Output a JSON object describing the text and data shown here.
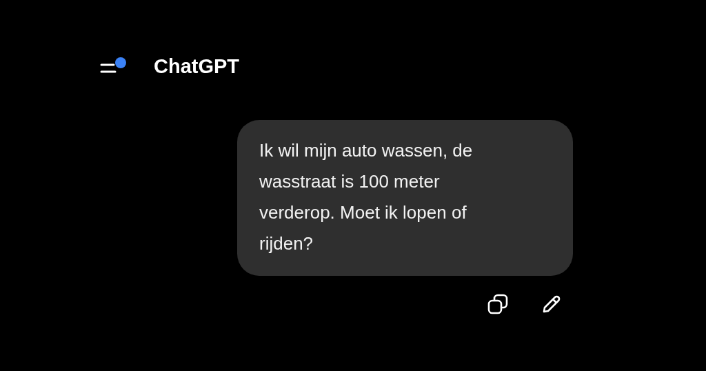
{
  "header": {
    "title": "ChatGPT",
    "menu_badge": true
  },
  "message": {
    "lines": [
      "Ik wil mijn auto wassen, de",
      "wasstraat is 100 meter",
      "verderop. Moet ik lopen of",
      "rijden?"
    ]
  }
}
